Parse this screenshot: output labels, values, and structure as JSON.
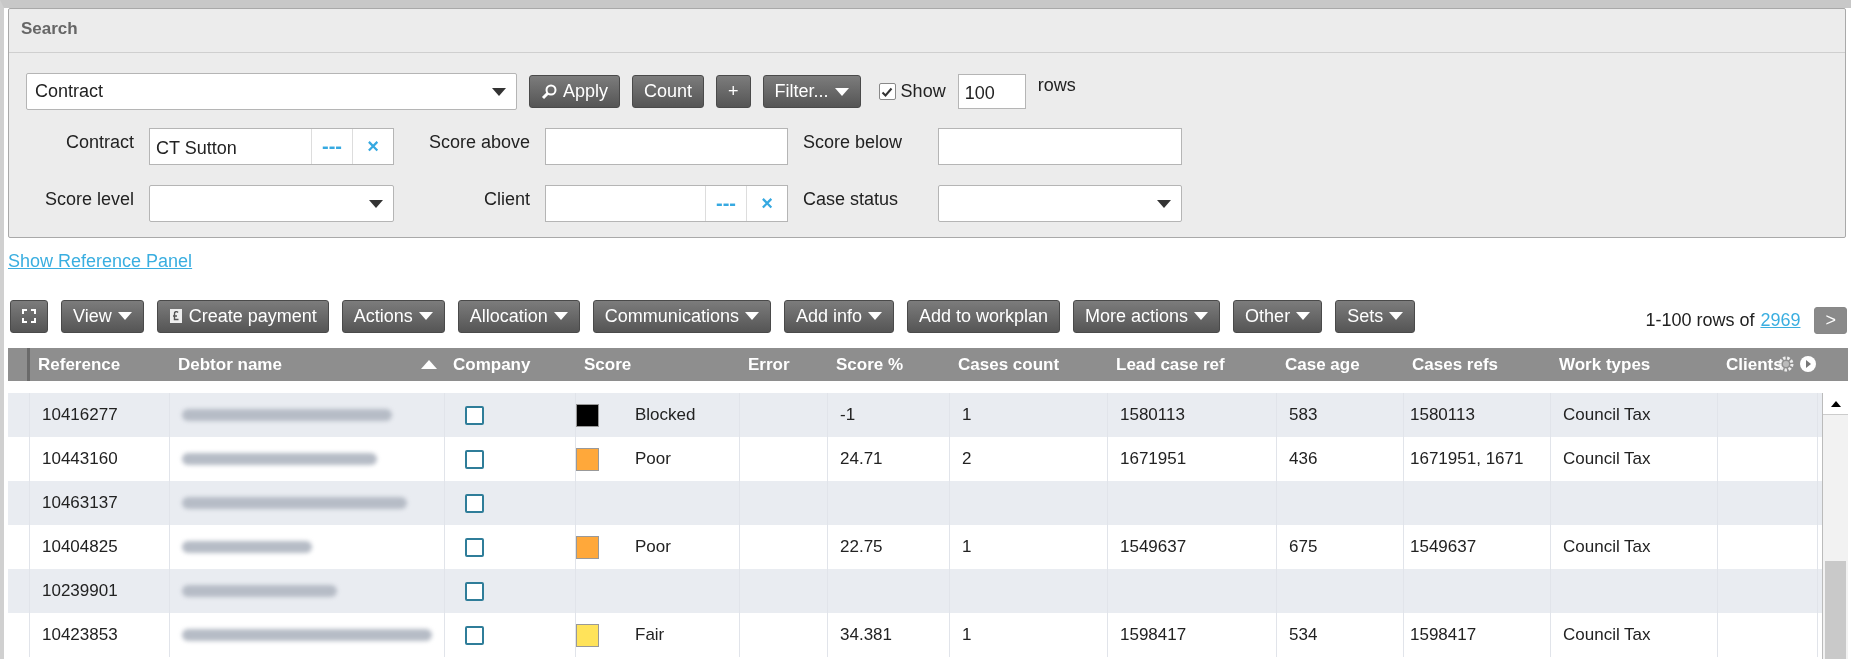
{
  "search": {
    "title": "Search",
    "entity_select": {
      "value": "Contract"
    },
    "buttons": [
      {
        "kind": "search",
        "label": "Apply"
      },
      {
        "kind": "plain",
        "label": "Count"
      },
      {
        "kind": "plain",
        "label": "+"
      },
      {
        "kind": "menu",
        "label": "Filter..."
      }
    ],
    "show_rows": {
      "checked": true,
      "label": "Show",
      "value": "100",
      "suffix": "rows"
    },
    "fields": [
      {
        "kind": "lookup",
        "label": "Contract",
        "value": "CT Sutton",
        "dots": "---",
        "clear": "×"
      },
      {
        "kind": "text",
        "label": "Score above"
      },
      {
        "kind": "text",
        "label": "Score below"
      },
      {
        "kind": "select",
        "label": "Score level"
      },
      {
        "kind": "lookup",
        "label": "Client",
        "dots": "---",
        "clear": "×"
      },
      {
        "kind": "select",
        "label": "Case status"
      }
    ]
  },
  "reference_link": "Show Reference Panel",
  "toolbar": {
    "buttons": [
      {
        "kind": "fullscreen"
      },
      {
        "kind": "menu",
        "label": "View"
      },
      {
        "kind": "payment",
        "label": "Create payment"
      },
      {
        "kind": "menu",
        "label": "Actions"
      },
      {
        "kind": "menu",
        "label": "Allocation"
      },
      {
        "kind": "menu",
        "label": "Communications"
      },
      {
        "kind": "menu",
        "label": "Add info"
      },
      {
        "kind": "plain",
        "label": "Add to workplan"
      },
      {
        "kind": "menu",
        "label": "More actions"
      },
      {
        "kind": "menu",
        "label": "Other"
      },
      {
        "kind": "menu",
        "label": "Sets"
      }
    ],
    "pager": {
      "range": "1-100 rows of",
      "total": "2969",
      "next": ">"
    }
  },
  "table": {
    "columns": [
      {
        "label": "Reference",
        "sorted": false
      },
      {
        "label": "Debtor name",
        "sorted": true
      },
      {
        "label": "Company",
        "sorted": false
      },
      {
        "label": "Score",
        "sorted": false
      },
      {
        "label": "Error",
        "sorted": false
      },
      {
        "label": "Score %",
        "sorted": false
      },
      {
        "label": "Cases count",
        "sorted": false
      },
      {
        "label": "Lead case ref",
        "sorted": false
      },
      {
        "label": "Case age",
        "sorted": false
      },
      {
        "label": "Cases refs",
        "sorted": false
      },
      {
        "label": "Work types",
        "sorted": false
      },
      {
        "label": "Clients",
        "sorted": false
      }
    ],
    "rows": [
      {
        "reference": "10416277",
        "company_checked": false,
        "score": {
          "label": "Blocked",
          "color": "#000000"
        },
        "score_pct": "-1",
        "cases_count": "1",
        "lead_case_ref": "1580113",
        "case_age": "583",
        "cases_refs": "1580113",
        "work_types": "Council Tax"
      },
      {
        "reference": "10443160",
        "company_checked": false,
        "score": {
          "label": "Poor",
          "color": "#ffa83a"
        },
        "score_pct": "24.71",
        "cases_count": "2",
        "lead_case_ref": "1671951",
        "case_age": "436",
        "cases_refs": "1671951, 1671",
        "work_types": "Council Tax"
      },
      {
        "reference": "10463137",
        "company_checked": false
      },
      {
        "reference": "10404825",
        "company_checked": false,
        "score": {
          "label": "Poor",
          "color": "#ffa83a"
        },
        "score_pct": "22.75",
        "cases_count": "1",
        "lead_case_ref": "1549637",
        "case_age": "675",
        "cases_refs": "1549637",
        "work_types": "Council Tax"
      },
      {
        "reference": "10239901",
        "company_checked": false
      },
      {
        "reference": "10423853",
        "company_checked": false,
        "score": {
          "label": "Fair",
          "color": "#ffe35a"
        },
        "score_pct": "34.381",
        "cases_count": "1",
        "lead_case_ref": "1598417",
        "case_age": "534",
        "cases_refs": "1598417",
        "work_types": "Council Tax"
      }
    ]
  }
}
